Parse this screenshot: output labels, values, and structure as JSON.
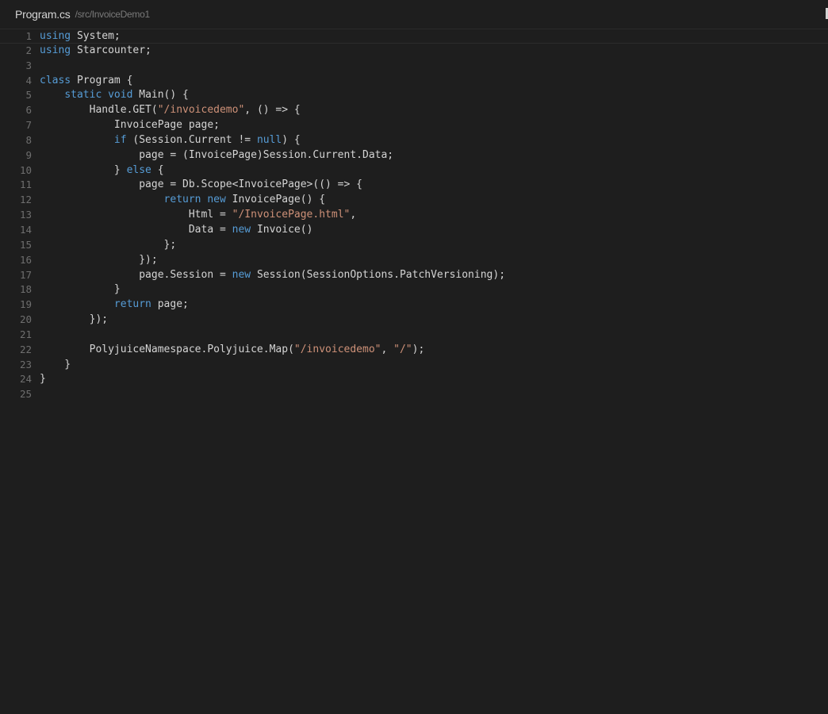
{
  "tab": {
    "filename": "Program.cs",
    "path": "/src/InvoiceDemo1"
  },
  "theme": {
    "background": "#1e1e1e",
    "keyword": "#569cd6",
    "string": "#ce9178",
    "text": "#d4d4d4",
    "line_number": "#6e6e6e"
  },
  "code": {
    "current_line": 1,
    "lines": [
      {
        "n": "1",
        "tokens": [
          {
            "t": "kw",
            "v": "using"
          },
          {
            "t": "plain",
            "v": " System;"
          }
        ]
      },
      {
        "n": "2",
        "tokens": [
          {
            "t": "kw",
            "v": "using"
          },
          {
            "t": "plain",
            "v": " Starcounter;"
          }
        ]
      },
      {
        "n": "3",
        "tokens": []
      },
      {
        "n": "4",
        "tokens": [
          {
            "t": "kw",
            "v": "class"
          },
          {
            "t": "plain",
            "v": " Program {"
          }
        ]
      },
      {
        "n": "5",
        "tokens": [
          {
            "t": "plain",
            "v": "    "
          },
          {
            "t": "kw",
            "v": "static"
          },
          {
            "t": "plain",
            "v": " "
          },
          {
            "t": "kw",
            "v": "void"
          },
          {
            "t": "plain",
            "v": " Main() {"
          }
        ]
      },
      {
        "n": "6",
        "tokens": [
          {
            "t": "plain",
            "v": "        Handle.GET("
          },
          {
            "t": "str",
            "v": "\"/invoicedemo\""
          },
          {
            "t": "plain",
            "v": ", () => {"
          }
        ]
      },
      {
        "n": "7",
        "tokens": [
          {
            "t": "plain",
            "v": "            InvoicePage page;"
          }
        ]
      },
      {
        "n": "8",
        "tokens": [
          {
            "t": "plain",
            "v": "            "
          },
          {
            "t": "kw",
            "v": "if"
          },
          {
            "t": "plain",
            "v": " (Session.Current != "
          },
          {
            "t": "kw",
            "v": "null"
          },
          {
            "t": "plain",
            "v": ") {"
          }
        ]
      },
      {
        "n": "9",
        "tokens": [
          {
            "t": "plain",
            "v": "                page = (InvoicePage)Session.Current.Data;"
          }
        ]
      },
      {
        "n": "10",
        "tokens": [
          {
            "t": "plain",
            "v": "            } "
          },
          {
            "t": "kw",
            "v": "else"
          },
          {
            "t": "plain",
            "v": " {"
          }
        ]
      },
      {
        "n": "11",
        "tokens": [
          {
            "t": "plain",
            "v": "                page = Db.Scope<InvoicePage>(() => {"
          }
        ]
      },
      {
        "n": "12",
        "tokens": [
          {
            "t": "plain",
            "v": "                    "
          },
          {
            "t": "kw",
            "v": "return"
          },
          {
            "t": "plain",
            "v": " "
          },
          {
            "t": "kw",
            "v": "new"
          },
          {
            "t": "plain",
            "v": " InvoicePage() {"
          }
        ]
      },
      {
        "n": "13",
        "tokens": [
          {
            "t": "plain",
            "v": "                        Html = "
          },
          {
            "t": "str",
            "v": "\"/InvoicePage.html\""
          },
          {
            "t": "plain",
            "v": ","
          }
        ]
      },
      {
        "n": "14",
        "tokens": [
          {
            "t": "plain",
            "v": "                        Data = "
          },
          {
            "t": "kw",
            "v": "new"
          },
          {
            "t": "plain",
            "v": " Invoice()"
          }
        ]
      },
      {
        "n": "15",
        "tokens": [
          {
            "t": "plain",
            "v": "                    };"
          }
        ]
      },
      {
        "n": "16",
        "tokens": [
          {
            "t": "plain",
            "v": "                });"
          }
        ]
      },
      {
        "n": "17",
        "tokens": [
          {
            "t": "plain",
            "v": "                page.Session = "
          },
          {
            "t": "kw",
            "v": "new"
          },
          {
            "t": "plain",
            "v": " Session(SessionOptions.PatchVersioning);"
          }
        ]
      },
      {
        "n": "18",
        "tokens": [
          {
            "t": "plain",
            "v": "            }"
          }
        ]
      },
      {
        "n": "19",
        "tokens": [
          {
            "t": "plain",
            "v": "            "
          },
          {
            "t": "kw",
            "v": "return"
          },
          {
            "t": "plain",
            "v": " page;"
          }
        ]
      },
      {
        "n": "20",
        "tokens": [
          {
            "t": "plain",
            "v": "        });"
          }
        ]
      },
      {
        "n": "21",
        "tokens": []
      },
      {
        "n": "22",
        "tokens": [
          {
            "t": "plain",
            "v": "        PolyjuiceNamespace.Polyjuice.Map("
          },
          {
            "t": "str",
            "v": "\"/invoicedemo\""
          },
          {
            "t": "plain",
            "v": ", "
          },
          {
            "t": "str",
            "v": "\"/\""
          },
          {
            "t": "plain",
            "v": ");"
          }
        ]
      },
      {
        "n": "23",
        "tokens": [
          {
            "t": "plain",
            "v": "    }"
          }
        ]
      },
      {
        "n": "24",
        "tokens": [
          {
            "t": "plain",
            "v": "}"
          }
        ]
      },
      {
        "n": "25",
        "tokens": []
      }
    ]
  }
}
